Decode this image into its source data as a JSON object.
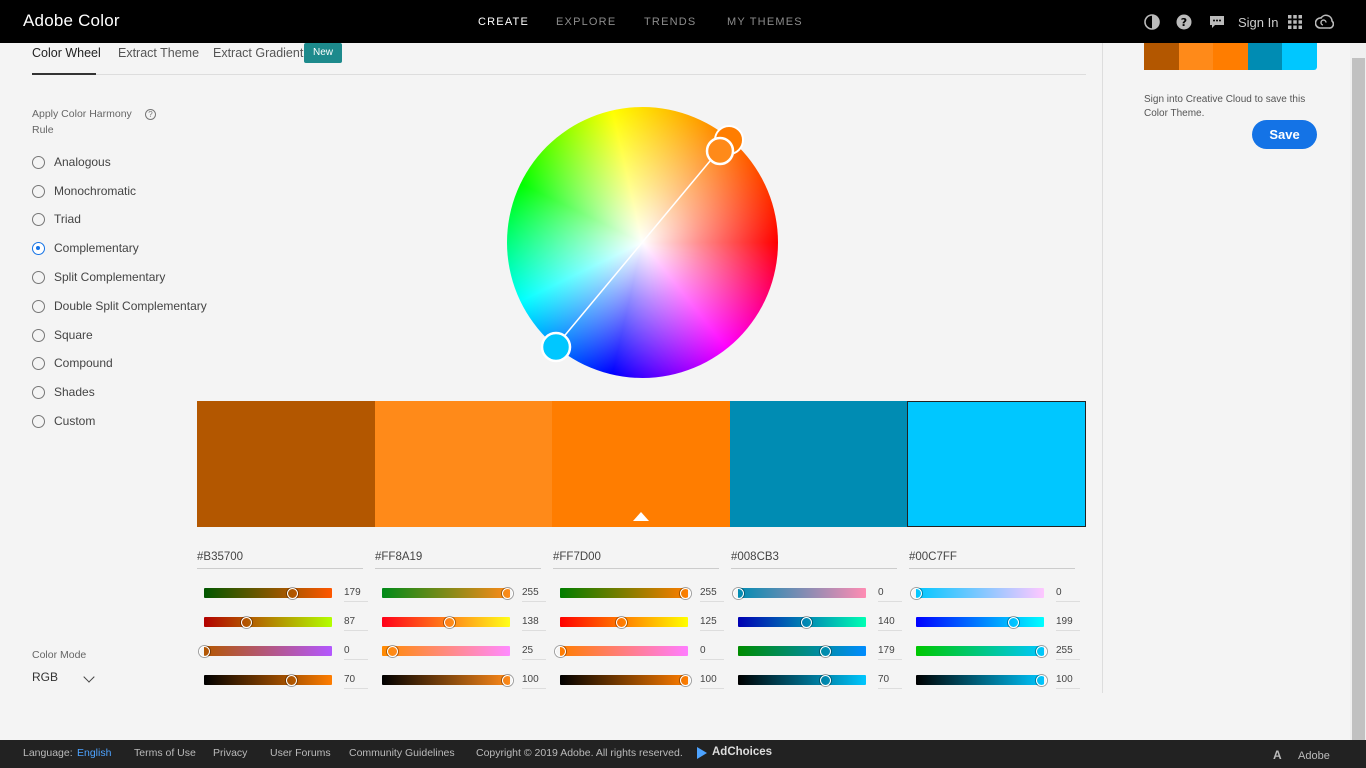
{
  "header": {
    "brand": "Adobe Color",
    "nav": [
      "CREATE",
      "EXPLORE",
      "TRENDS",
      "MY THEMES"
    ],
    "sign_in": "Sign In"
  },
  "tabs": {
    "items": [
      "Color Wheel",
      "Extract Theme",
      "Extract Gradient"
    ],
    "new_badge": "New"
  },
  "harmony": {
    "title": "Apply Color Harmony Rule",
    "help": "?",
    "rules": [
      "Analogous",
      "Monochromatic",
      "Triad",
      "Complementary",
      "Split Complementary",
      "Double Split Complementary",
      "Square",
      "Compound",
      "Shades",
      "Custom"
    ],
    "selected": "Complementary"
  },
  "swatches": [
    {
      "hex": "#B35700",
      "color": "#B35700",
      "sliders": [
        179,
        87,
        0,
        70
      ]
    },
    {
      "hex": "#FF8A19",
      "color": "#FF8A19",
      "sliders": [
        255,
        138,
        25,
        100
      ]
    },
    {
      "hex": "#FF7D00",
      "color": "#FF7D00",
      "sliders": [
        255,
        125,
        0,
        100
      ]
    },
    {
      "hex": "#008CB3",
      "color": "#008CB3",
      "sliders": [
        0,
        140,
        179,
        70
      ]
    },
    {
      "hex": "#00C7FF",
      "color": "#00C7FF",
      "sliders": [
        0,
        199,
        255,
        100
      ]
    }
  ],
  "slider_values_text": [
    [
      "179",
      "87",
      "0",
      "70"
    ],
    [
      "255",
      "138",
      "25",
      "100"
    ],
    [
      "255",
      "125",
      "0",
      "100"
    ],
    [
      "0",
      "140",
      "179",
      "70"
    ],
    [
      "0",
      "199",
      "255",
      "100"
    ]
  ],
  "color_mode": {
    "label": "Color Mode",
    "value": "RGB"
  },
  "right_panel": {
    "sign_in_note": "Sign into Creative Cloud to save this Color Theme.",
    "save_label": "Save"
  },
  "footer": {
    "language_label": "Language:",
    "language_value": "English",
    "links": [
      "Terms of Use",
      "Privacy",
      "User Forums",
      "Community Guidelines"
    ],
    "copyright": "Copyright © 2019 Adobe. All rights reserved.",
    "adchoices": "AdChoices",
    "adobe": "Adobe"
  },
  "icons": [
    "theme-toggle-icon",
    "help-icon",
    "feedback-icon",
    "apps-grid-icon",
    "creative-cloud-icon",
    "chevron-down-icon",
    "adchoices-icon"
  ],
  "colors": {
    "accent": "#1473e6",
    "new_badge": "#1d8a8c",
    "header_bg": "#000000"
  }
}
